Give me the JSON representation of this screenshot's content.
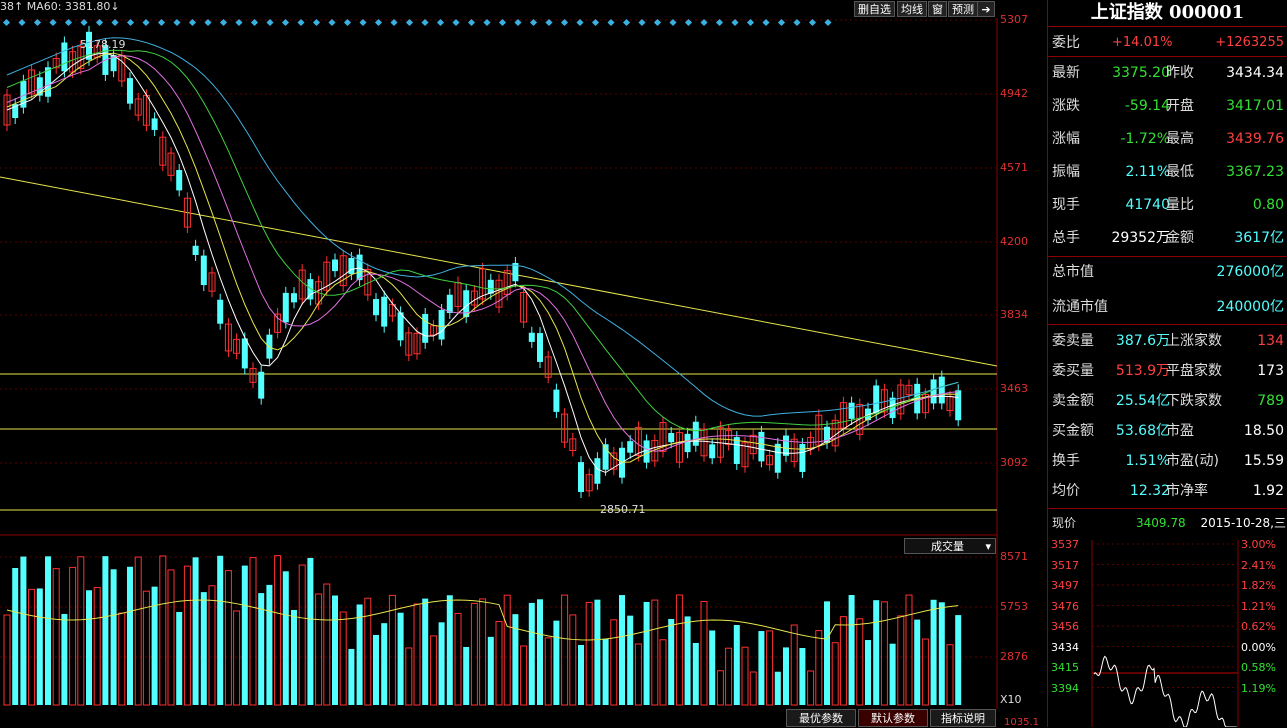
{
  "header": {
    "ma_prefix": "38↑",
    "ma60_label": "MA60: 3381.80↓",
    "buttons": [
      "删自选",
      "均线",
      "窗",
      "预测"
    ],
    "exit_icon": "exit-icon"
  },
  "chart": {
    "y_axis_labels": [
      "5307",
      "4942",
      "4571",
      "4200",
      "3834",
      "3463",
      "3092"
    ],
    "max_label": "5178.19",
    "min_label": "2850.71",
    "volume_dropdown": "成交量",
    "volume_axis_labels": [
      "8571",
      "5753",
      "2876"
    ],
    "volume_unit": "X10",
    "volume_bottom_label": "1035.1"
  },
  "bottom_buttons": [
    "最优参数",
    "默认参数",
    "指标说明"
  ],
  "panel": {
    "title": "上证指数 000001",
    "weibi": {
      "label": "委比",
      "pct": "+14.01%",
      "val": "+1263255"
    },
    "rows": [
      {
        "l1": "最新",
        "v1": "3375.20",
        "c1": "green",
        "l2": "昨收",
        "v2": "3434.34",
        "c2": "white"
      },
      {
        "l1": "涨跌",
        "v1": "-59.14",
        "c1": "green",
        "l2": "开盘",
        "v2": "3417.01",
        "c2": "green"
      },
      {
        "l1": "涨幅",
        "v1": "-1.72%",
        "c1": "green",
        "l2": "最高",
        "v2": "3439.76",
        "c2": "red"
      },
      {
        "l1": "振幅",
        "v1": "2.11%",
        "c1": "cyan",
        "l2": "最低",
        "v2": "3367.23",
        "c2": "green"
      },
      {
        "l1": "现手",
        "v1": "41740",
        "c1": "cyan",
        "l2": "量比",
        "v2": "0.80",
        "c2": "green"
      },
      {
        "l1": "总手",
        "v1": "29352万",
        "c1": "white",
        "l2": "金额",
        "v2": "3617亿",
        "c2": "cyan"
      }
    ],
    "market_cap": {
      "label": "总市值",
      "val": "276000亿"
    },
    "float_cap": {
      "label": "流通市值",
      "val": "240000亿"
    },
    "rows2": [
      {
        "l1": "委卖量",
        "v1": "387.6万",
        "c1": "cyan",
        "l2": "上涨家数",
        "v2": "134",
        "c2": "red"
      },
      {
        "l1": "委买量",
        "v1": "513.9万",
        "c1": "red",
        "l2": "平盘家数",
        "v2": "173",
        "c2": "white"
      },
      {
        "l1": "卖金额",
        "v1": "25.54亿",
        "c1": "cyan",
        "l2": "下跌家数",
        "v2": "789",
        "c2": "green"
      },
      {
        "l1": "买金额",
        "v1": "53.68亿",
        "c1": "cyan",
        "l2": "市盈",
        "v2": "18.50",
        "c2": "white"
      },
      {
        "l1": "换手",
        "v1": "1.51%",
        "c1": "cyan",
        "l2": "市盈(动)",
        "v2": "15.59",
        "c2": "white"
      },
      {
        "l1": "均价",
        "v1": "12.32",
        "c1": "cyan",
        "l2": "市净率",
        "v2": "1.92",
        "c2": "white"
      }
    ],
    "current": {
      "label": "现价",
      "val": "3409.78",
      "date": "2015-10-28,三"
    },
    "mini_left": [
      "3537",
      "3517",
      "3497",
      "3476",
      "3456",
      "3434",
      "3415",
      "3394"
    ],
    "mini_right": [
      "3.00%",
      "2.41%",
      "1.82%",
      "1.21%",
      "0.62%",
      "0.00%",
      "0.58%",
      "1.19%"
    ]
  }
}
